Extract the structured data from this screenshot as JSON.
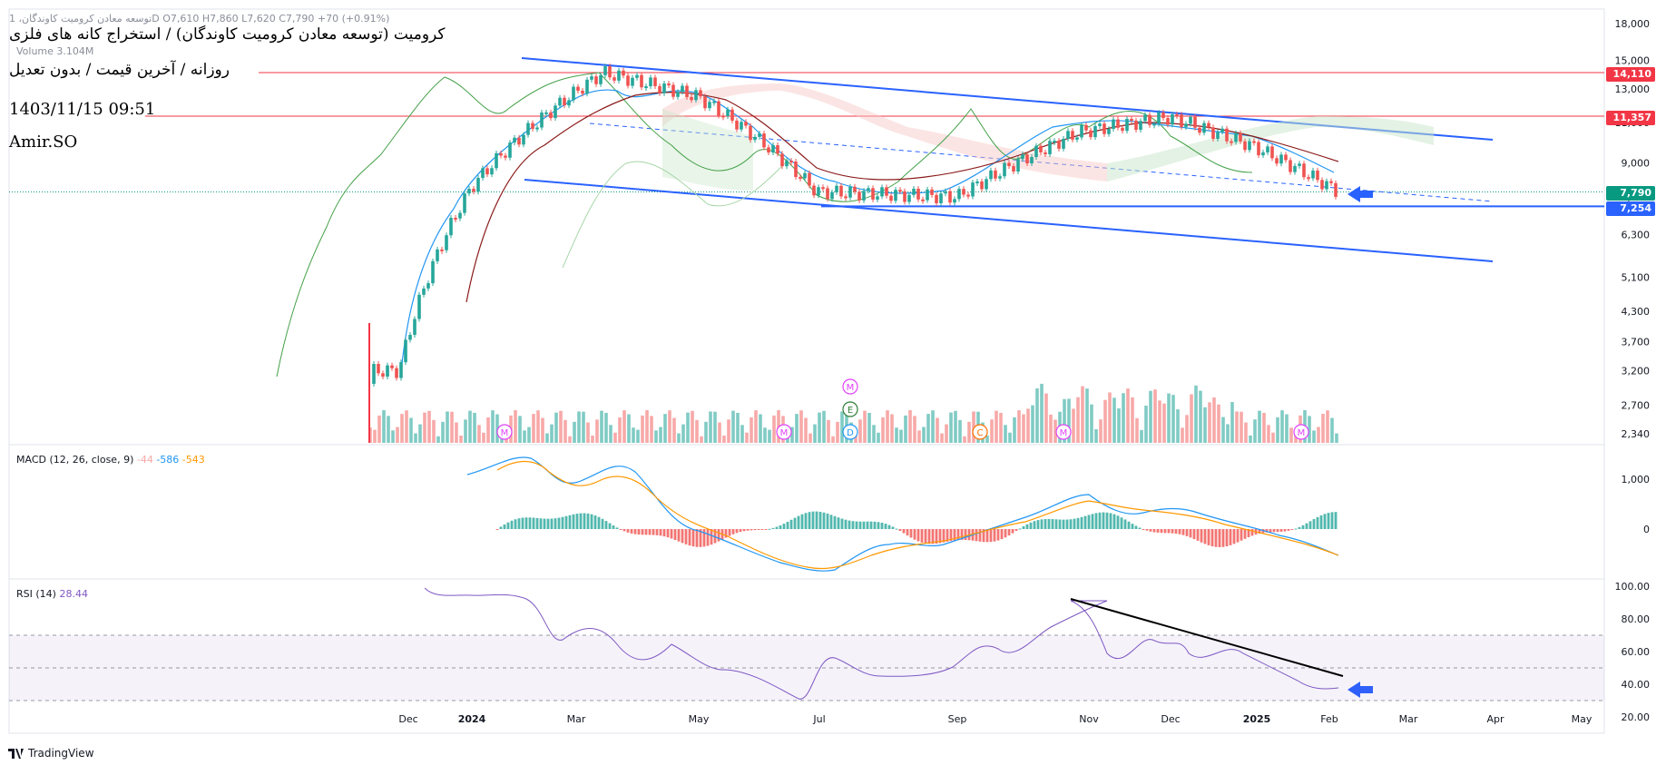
{
  "header": {
    "symbol_line": "توسعه معادن کرومیت کاوندگان، 1D  O7,610  H7,860  L7,620  C7,790  +70 (+0.91%)",
    "volume_line": "Volume  3.104M",
    "title_fa": "کرومیت (توسعه معادن کرومیت کاوندگان) / استخراج کانه های فلزی",
    "subtitle_fa": "روزانه / آخرین قیمت / بدون تعدیل",
    "datetime": "1403/11/15 09:51",
    "author": "Amir.SO"
  },
  "price_axis": {
    "ticks": [
      "18,000",
      "15,000",
      "13,000",
      "11,000",
      "9,000",
      "7,600",
      "6,300",
      "5,100",
      "4,300",
      "3,700",
      "3,200",
      "2,700",
      "2,340"
    ],
    "badges": [
      {
        "label": "14,110",
        "color": "#f23645"
      },
      {
        "label": "11,357",
        "color": "#f23645"
      },
      {
        "label": "7,790",
        "color": "#089981"
      },
      {
        "label": "7,254",
        "color": "#2962ff"
      }
    ]
  },
  "macd": {
    "legend_name": "MACD (12, 26, close, 9)",
    "hist": "-44",
    "macd": "-586",
    "signal": "-543",
    "ticks": [
      "1,000",
      "0"
    ]
  },
  "rsi": {
    "legend_name": "RSI (14)",
    "value": "28.44",
    "ticks": [
      "100.00",
      "80.00",
      "60.00",
      "40.00",
      "20.00"
    ]
  },
  "time_axis": [
    "Dec",
    "2024",
    "Mar",
    "May",
    "Jul",
    "Sep",
    "Nov",
    "Dec",
    "2025",
    "Feb",
    "Mar",
    "Apr",
    "May"
  ],
  "event_markers": [
    "M",
    "E",
    "D",
    "M",
    "M",
    "C",
    "M",
    "M",
    "M"
  ],
  "brand": "TradingView",
  "colors": {
    "up": "#26a69a",
    "down": "#ef5350",
    "trend": "#2962ff",
    "macd": "#2196f3",
    "signal": "#ff9800",
    "rsi": "#7e57c2"
  },
  "chart_data": {
    "type": "line",
    "title": "کرومیت (توسعه معادن کرومیت کاوندگان) / استخراج کانه های فلزی",
    "x": [
      "Dec",
      "2024",
      "Mar",
      "May",
      "Jul",
      "Sep",
      "Nov",
      "Dec",
      "2025",
      "Feb"
    ],
    "series": [
      {
        "values": [
          3200,
          8000,
          14100,
          12500,
          7800,
          7600,
          10500,
          11300,
          9800,
          7790
        ]
      }
    ],
    "levels": [
      14110,
      11357,
      7790,
      7254
    ],
    "ylabel": "",
    "ylim": [
      2340,
      18000
    ],
    "y_scale": "log",
    "indicators": [
      {
        "name": "MACD (12, 26, close, 9)",
        "values": {
          "hist": -44,
          "macd": -586,
          "signal": -543
        }
      },
      {
        "name": "RSI (14)",
        "value": 28.44,
        "ylim": [
          20,
          100
        ]
      }
    ]
  }
}
